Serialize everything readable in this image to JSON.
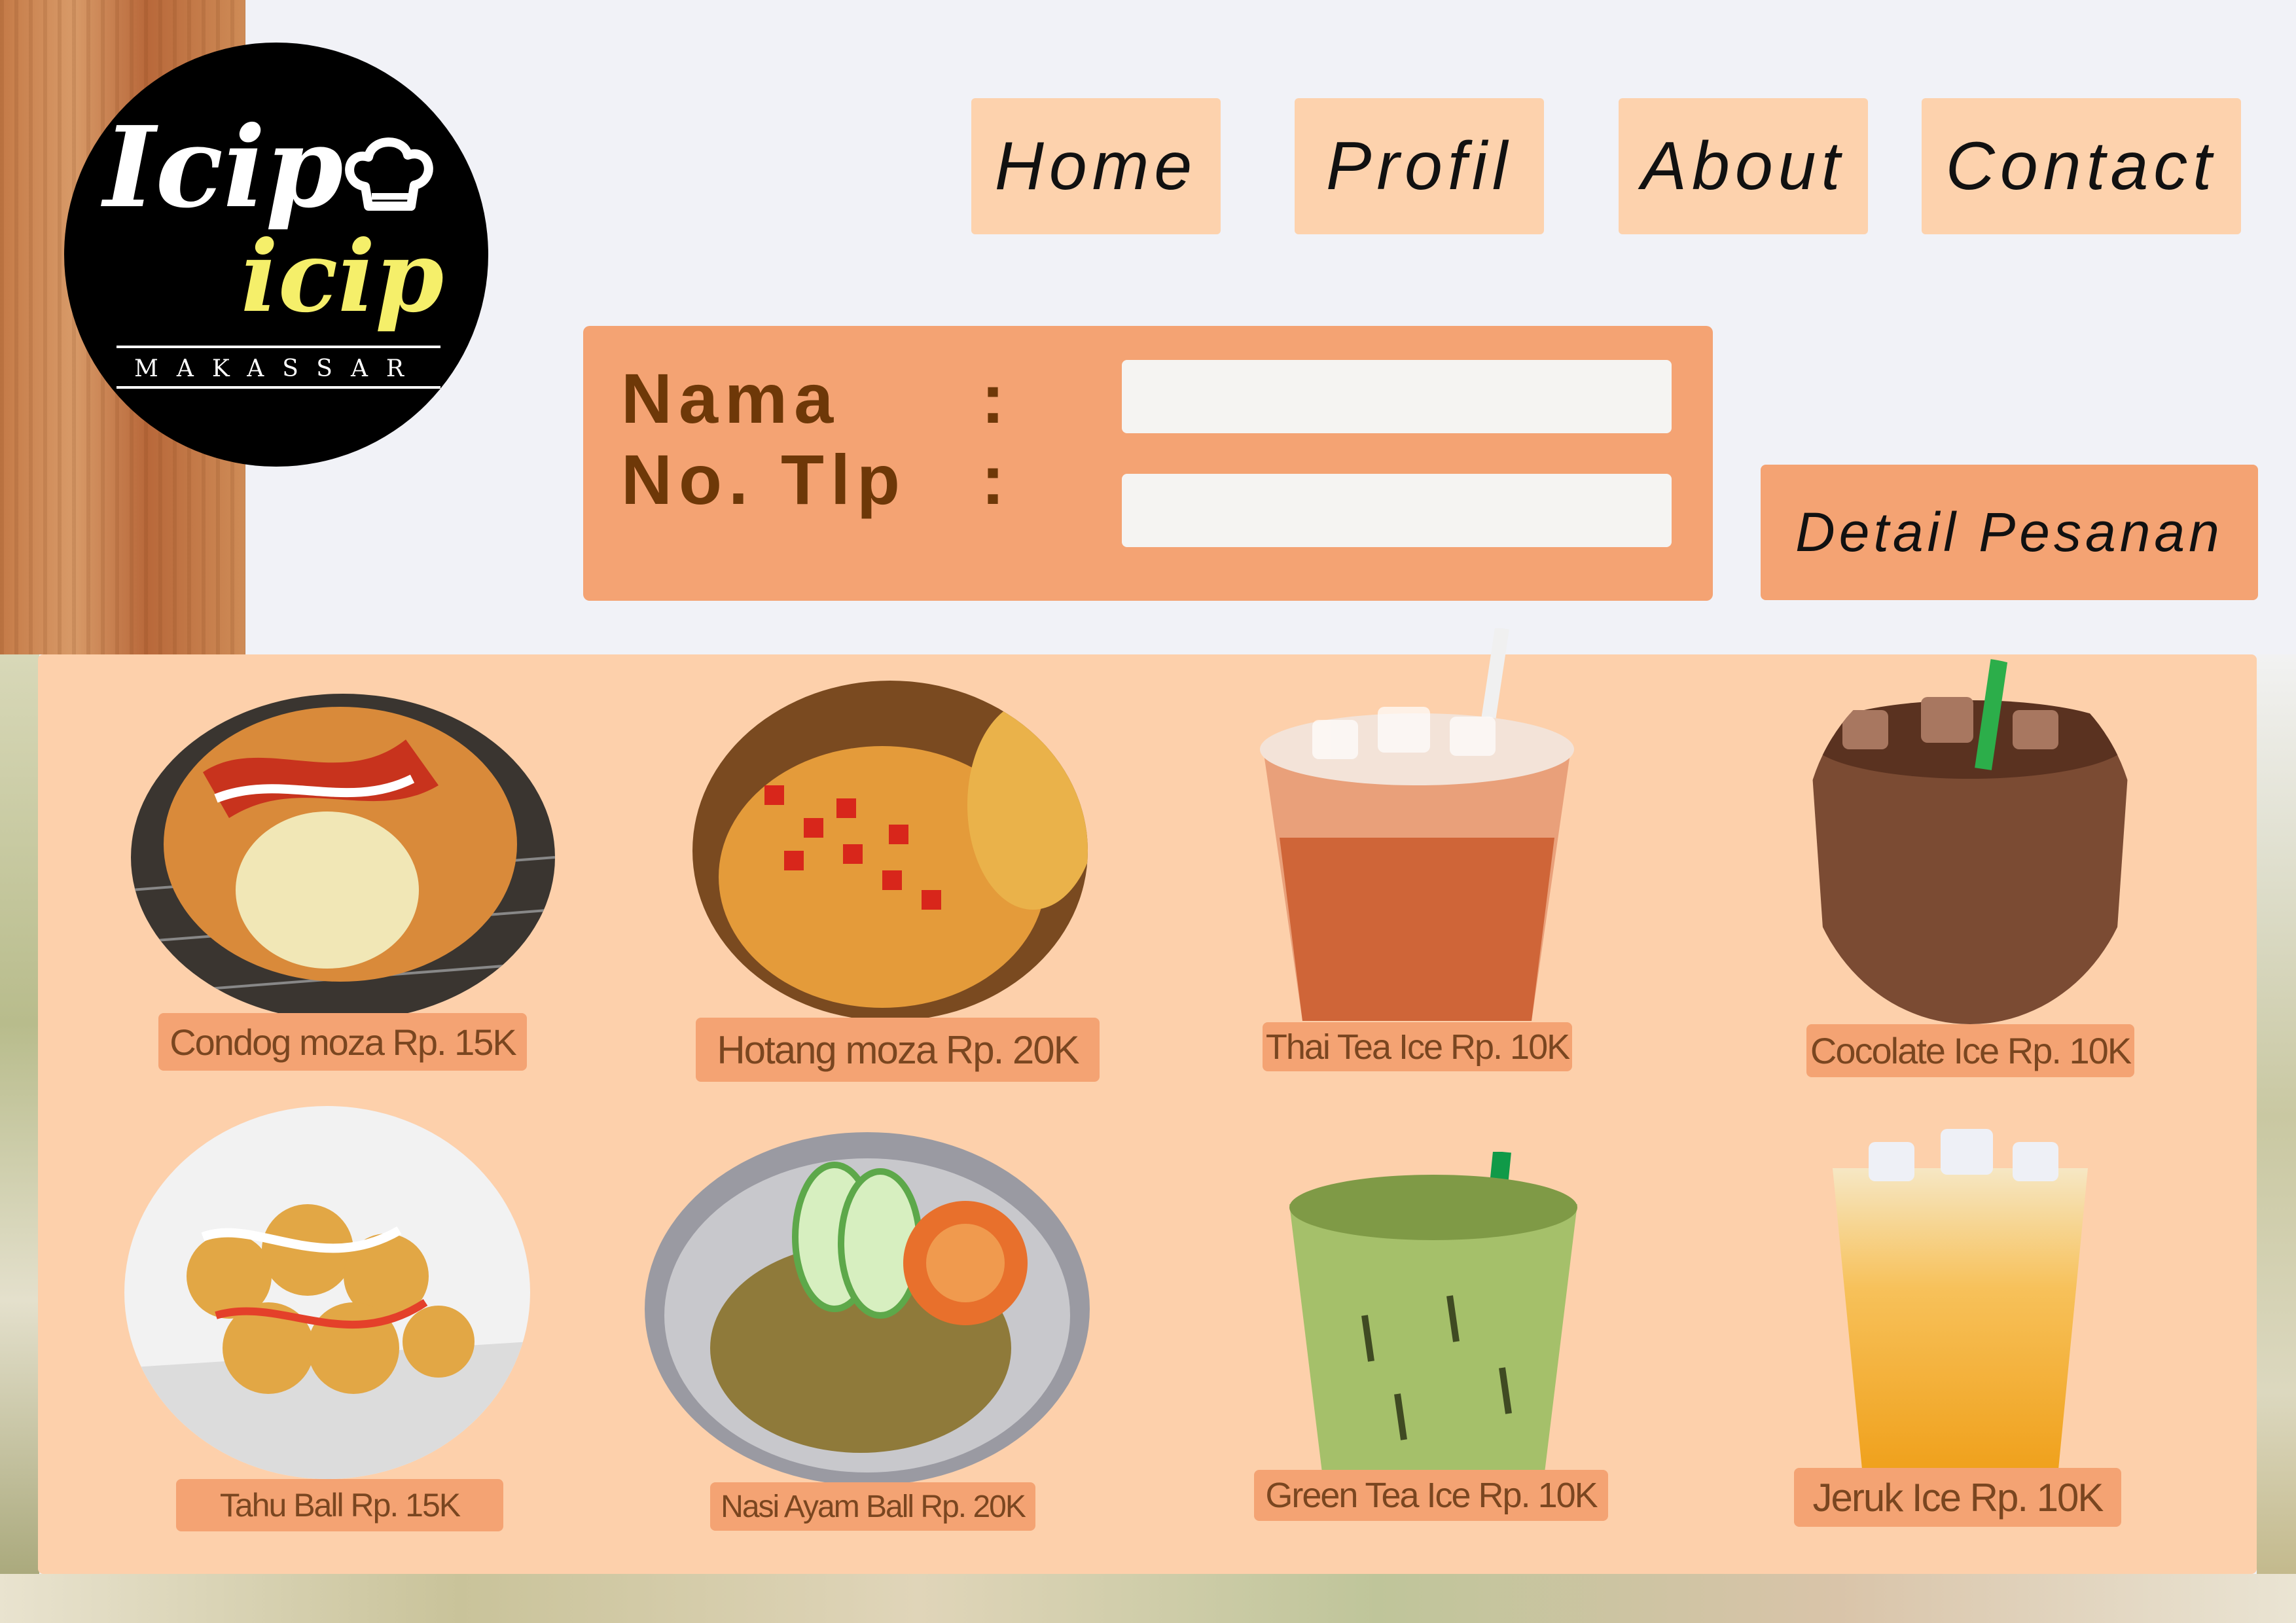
{
  "logo": {
    "line1": "Icip",
    "line2": "icip",
    "city": "MAKASSAR",
    "icon": "chef-hat-icon"
  },
  "nav": {
    "items": [
      {
        "label": "Home"
      },
      {
        "label": "Profil"
      },
      {
        "label": "About"
      },
      {
        "label": "Contact"
      }
    ]
  },
  "form": {
    "name_label": "Nama",
    "phone_label": "No. Tlp",
    "colon": ":",
    "name_value": "",
    "phone_value": ""
  },
  "detail_button": "Detail Pesanan",
  "menu": {
    "items": [
      {
        "label": "Condog moza Rp. 15K"
      },
      {
        "label": "Hotang moza Rp. 20K"
      },
      {
        "label": "Thai Tea Ice Rp. 10K"
      },
      {
        "label": "Cocolate Ice Rp. 10K"
      },
      {
        "label": "Tahu Ball Rp. 15K"
      },
      {
        "label": "Nasi Ayam Ball Rp. 20K"
      },
      {
        "label": "Green Tea Ice Rp. 10K"
      },
      {
        "label": "Jeruk Ice Rp. 10K"
      }
    ]
  },
  "colors": {
    "accent": "#f4a373",
    "panel": "#fdd0ab",
    "nav": "#fdd2ad",
    "text_dark": "#6e3808"
  }
}
